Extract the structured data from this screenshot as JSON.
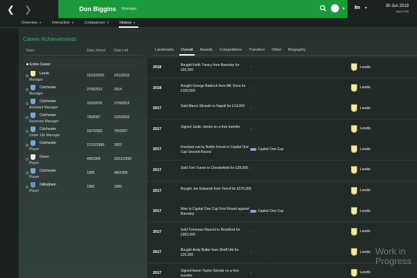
{
  "header": {
    "manager_name": "Don Biggins",
    "manager_role": "Manager",
    "date": "30 Jun 2019",
    "time": "Sun 6.00",
    "logo": "fm"
  },
  "subnav": [
    {
      "label": "Overview",
      "has_caret": true
    },
    {
      "label": "Interaction",
      "has_caret": true
    },
    {
      "label": "Comparison",
      "has_caret": true
    },
    {
      "label": "History",
      "has_caret": true,
      "active": true
    }
  ],
  "page_title": "Career Achievements",
  "career_table": {
    "headers": {
      "team": "Team",
      "joined": "Date Joined",
      "left": "Date Left"
    },
    "entire_label": "Entire Career",
    "rows": [
      {
        "club": "Leeds",
        "role": "Manager",
        "joined": "10/12/2015",
        "left": "3/11/2018",
        "crest": "#f2e8a8"
      },
      {
        "club": "Colchester",
        "role": "Manager",
        "joined": "27/9/2012",
        "left": "2014",
        "crest": "#7da6d8"
      },
      {
        "club": "Colchester",
        "role": "Assistant Manager",
        "joined": "31/5/2010",
        "left": "27/9/2012",
        "crest": "#7da6d8"
      },
      {
        "club": "Colchester",
        "role": "Reserves Manager",
        "joined": "7/8/2007",
        "left": "31/5/2010",
        "crest": "#7da6d8"
      },
      {
        "club": "Colchester",
        "role": "Under 18s Manager",
        "joined": "15/7/2003",
        "left": "7/8/2007",
        "crest": "#7da6d8"
      },
      {
        "club": "Colchester",
        "role": "Player",
        "joined": "17/12/1999",
        "left": "2002",
        "crest": "#7da6d8"
      },
      {
        "club": "Dover",
        "role": "Player",
        "joined": "4/8/1999",
        "left": "15/12/1999",
        "crest": "#e8ecef"
      },
      {
        "club": "Colchester",
        "role": "Player",
        "joined": "1995",
        "left": "4/8/1999",
        "crest": "#7da6d8"
      },
      {
        "club": "Gillingham",
        "role": "Player",
        "joined": "1990",
        "left": "1995",
        "crest": "#6a8fd0"
      }
    ]
  },
  "tabs": [
    {
      "label": "Landmarks"
    },
    {
      "label": "Overall",
      "active": true
    },
    {
      "label": "Awards"
    },
    {
      "label": "Competitions"
    },
    {
      "label": "Transfers"
    },
    {
      "label": "Other"
    },
    {
      "label": "Biography"
    }
  ],
  "events": [
    {
      "year": "2018",
      "desc": "Bought Keith Treacy from Barnsley for £65,000",
      "comp": "-",
      "club": "Leeds"
    },
    {
      "year": "2018",
      "desc": "Bought George Baldock from MK Dons for £100,000",
      "comp": "-",
      "club": "Leeds"
    },
    {
      "year": "2017",
      "desc": "Sold Marco Silvestri to Napoli for £14,000",
      "comp": "-",
      "club": "Leeds"
    },
    {
      "year": "2017",
      "desc": "Signed Justin James on a free transfer",
      "comp": "-",
      "club": "Leeds"
    },
    {
      "year": "2017",
      "desc": "Knocked out by Nottm Forest in Capital One Cup Second Round",
      "comp": "Capital One Cup",
      "comp_icon": true,
      "club": "Leeds"
    },
    {
      "year": "2017",
      "desc": "Sold Tom Turner to Chesterfield for £28,000",
      "comp": "-",
      "club": "Leeds"
    },
    {
      "year": "2017",
      "desc": "Bought Joe Edwards from Yeovil for £575,000",
      "comp": "-",
      "club": "Leeds"
    },
    {
      "year": "2017",
      "desc": "Won in Capital One Cup First Round against Barnsley",
      "comp": "Capital One Cup",
      "comp_icon": true,
      "club": "Leeds"
    },
    {
      "year": "2017",
      "desc": "Sold Tommaso Bianchi to Brentford for £950,000",
      "comp": "-",
      "club": "Leeds"
    },
    {
      "year": "2017",
      "desc": "Bought Andy Butler from Sheff Utd for £26,000",
      "comp": "-",
      "club": "Leeds"
    },
    {
      "year": "2017",
      "desc": "Signed Aaron Taylor-Sinclair on a free transfer",
      "comp": "-",
      "club": "Leeds"
    }
  ],
  "watermark": "Work in Progress"
}
